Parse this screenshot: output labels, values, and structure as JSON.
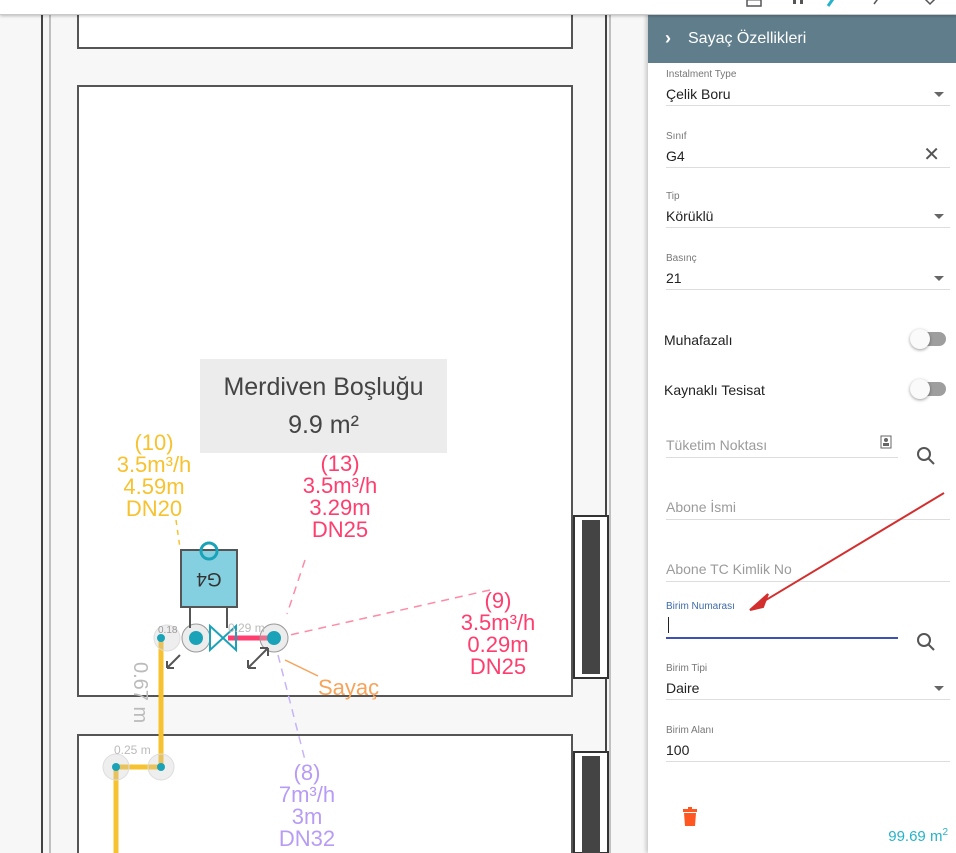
{
  "canvas": {
    "room_name": "Merdiven Boşluğu",
    "room_area": "9.9 m²",
    "meter_label": "G4",
    "meter_caption": "Sayaç",
    "small_labels": [
      "0.18",
      "0.29 m",
      "0.25 m",
      "0.67 m"
    ],
    "pipes": [
      {
        "id": "(10)",
        "flow": "3.5m³/h",
        "length": "4.59m",
        "dn": "DN20",
        "color": "#f7c22f"
      },
      {
        "id": "(13)",
        "flow": "3.5m³/h",
        "length": "3.29m",
        "dn": "DN25",
        "color": "#ff3d6e"
      },
      {
        "id": "(9)",
        "flow": "3.5m³/h",
        "length": "0.29m",
        "dn": "DN25",
        "color": "#ff3d6e"
      },
      {
        "id": "(8)",
        "flow": "7m³/h",
        "length": "3m",
        "dn": "DN32",
        "color": "#b79cf5"
      }
    ]
  },
  "panel": {
    "title": "Sayaç Özellikleri",
    "fields": {
      "instalment_type": {
        "label": "Instalment Type",
        "value": "Çelik Boru"
      },
      "sinif": {
        "label": "Sınıf",
        "value": "G4"
      },
      "tip": {
        "label": "Tip",
        "value": "Körüklü"
      },
      "basinc": {
        "label": "Basınç",
        "value": "21"
      },
      "muhafazali": {
        "label": "Muhafazalı",
        "on": false
      },
      "kaynakli": {
        "label": "Kaynaklı Tesisat",
        "on": false
      },
      "tuketim_noktasi": {
        "placeholder": "Tüketim Noktası"
      },
      "abone_ismi": {
        "placeholder": "Abone İsmi"
      },
      "abone_tc": {
        "placeholder": "Abone TC Kimlik No"
      },
      "birim_numarasi": {
        "label": "Birim Numarası",
        "value": ""
      },
      "birim_tipi": {
        "label": "Birim Tipi",
        "value": "Daire"
      },
      "birim_alani": {
        "label": "Birim Alanı",
        "value": "100"
      }
    },
    "total_area_value": "99.69 m",
    "total_area_unit_sup": "2"
  },
  "icons": {
    "header": "chevron-right-icon",
    "dropdown": "triangle-down-icon",
    "clear": "close-icon",
    "search": "search-icon",
    "delete": "trash-icon",
    "id_card": "contact-card-icon"
  },
  "colors": {
    "panel_header": "#607d8b",
    "focus": "#3f51b5",
    "total": "#26b3c9",
    "delete": "#ff5722",
    "annotation_arrow": "#d32f2f"
  }
}
